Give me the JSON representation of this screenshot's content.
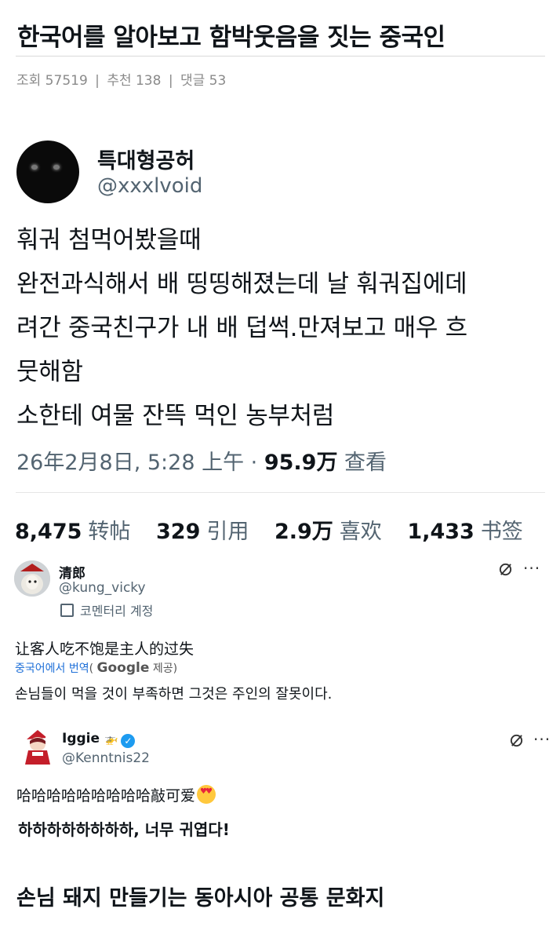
{
  "post": {
    "title": "한국어를 알아보고 함박웃음을 짓는 중국인",
    "views_label": "조회 57519",
    "recommend_label": "추천 138",
    "comments_label": "댓글 53",
    "separator": "|",
    "caption": "손님 돼지 만들기는 동아시아 공통 문화지"
  },
  "tweet": {
    "author_name": "특대형공허",
    "author_handle": "@xxxlvoid",
    "lines": [
      "훠궈 첨먹어봤을때",
      "완전과식해서 배 띵띵해졌는데 날 훠궈집에데",
      "려간 중국친구가 내 배 덥썩.만져보고 매우 흐",
      "뭇해함",
      "소한테 여물 잔뜩 먹인 농부처럼"
    ],
    "time": "26年2月8日, 5:28 上午 · ",
    "views": "95.9万",
    "views_label": " 查看",
    "stats": [
      {
        "value": "8,475",
        "label": "转帖"
      },
      {
        "value": "329",
        "label": "引用"
      },
      {
        "value": "2.9万",
        "label": "喜欢"
      },
      {
        "value": "1,433",
        "label": "书签"
      }
    ]
  },
  "replies": [
    {
      "name": "清郎",
      "handle": "@kung_vicky",
      "badge": "코멘터리 계정",
      "text": "让客人吃不饱是主人的过失",
      "translate_link": "중국어에서 번역",
      "translate_open": "(",
      "translate_brand": "Google",
      "translate_suffix": " 제공)",
      "translated": "손님들이 먹을 것이 부족하면 그것은 주인의 잘못이다."
    },
    {
      "name": "Iggie",
      "handle": "@Kenntnis22",
      "text": "哈哈哈哈哈哈哈哈哈敲可爱",
      "translated": "하하하하하하하하, 너무 귀엽다!"
    }
  ],
  "icons": {
    "more": "···",
    "verified_check": "✓"
  },
  "colors": {
    "link": "#1d6fd8",
    "verified": "#1d9bf0",
    "muted": "#536471"
  }
}
